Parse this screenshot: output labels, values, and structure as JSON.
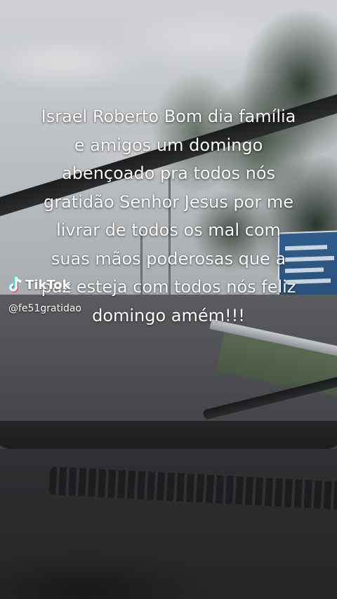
{
  "caption": {
    "lines": [
      "Israel Roberto Bom dia família",
      "e amigos um domingo",
      "abençoado pra todos nós",
      "gratidão Senhor Jesus por me",
      "livrar de todos os mal com",
      "suas mãos poderosas que a",
      "paz esteja com todos nós feliz",
      "domingo amém!!!"
    ]
  },
  "watermark": {
    "brand": "TikTok",
    "handle": "@fe51gratidao",
    "icon": "tiktok-logo-icon"
  },
  "colors": {
    "caption_text": "#ffffff",
    "sign_blue": "#2f5d8c"
  }
}
